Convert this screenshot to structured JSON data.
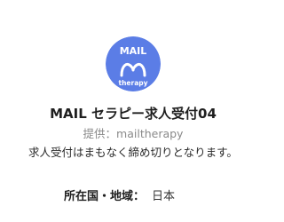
{
  "account": {
    "logo": {
      "line1": "MAIL",
      "line2": "therapy",
      "icon": "hands-heart-icon",
      "color": "#5b7de6"
    },
    "name": "MAIL セラピー求人受付04",
    "provider_text": "提供：mailtherapy",
    "notice": "求人受付はまもなく締め切りとなります。",
    "country_label": "所在国・地域：",
    "country_value": "日本"
  }
}
